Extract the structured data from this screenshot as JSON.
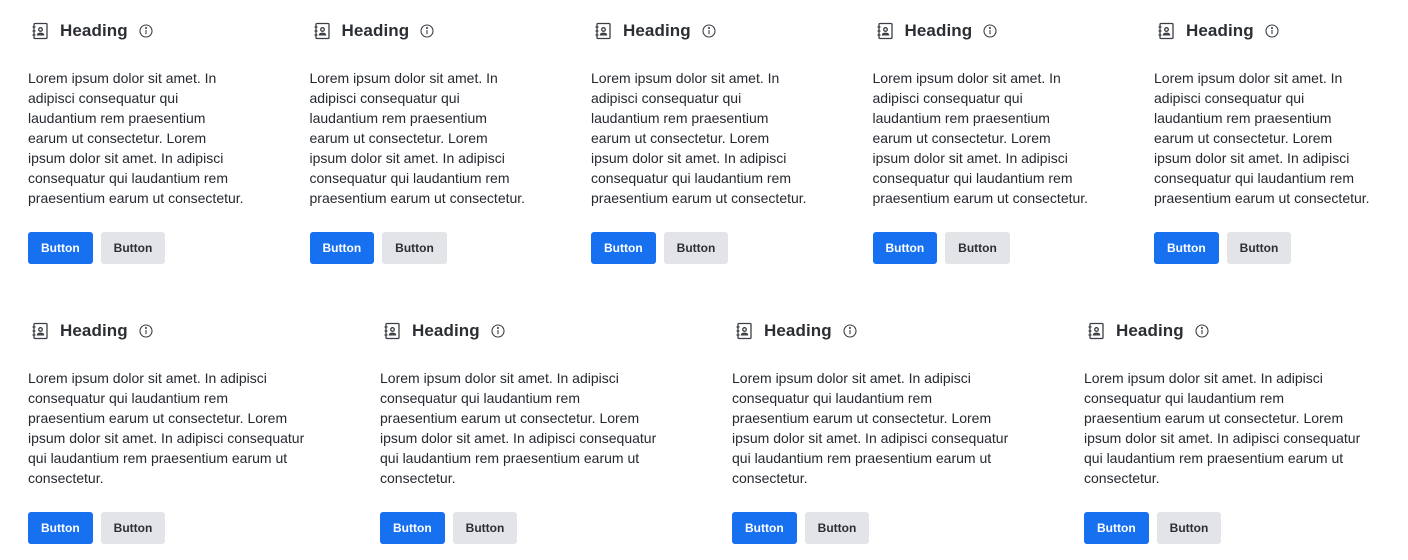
{
  "row1": [
    {
      "title": "Heading",
      "body": "Lorem ipsum dolor sit amet. In adipisci consequatur qui laudantium rem praesentium earum ut consectetur. Lorem ipsum dolor sit amet. In adipisci consequatur qui laudantium rem praesentium earum ut consectetur.",
      "primary_label": "Button",
      "secondary_label": "Button"
    },
    {
      "title": "Heading",
      "body": "Lorem ipsum dolor sit amet. In adipisci consequatur qui laudantium rem praesentium earum ut consectetur. Lorem ipsum dolor sit amet. In adipisci consequatur qui laudantium rem praesentium earum ut consectetur.",
      "primary_label": "Button",
      "secondary_label": "Button"
    },
    {
      "title": "Heading",
      "body": "Lorem ipsum dolor sit amet. In adipisci consequatur qui laudantium rem praesentium earum ut consectetur. Lorem ipsum dolor sit amet. In adipisci consequatur qui laudantium rem praesentium earum ut consectetur.",
      "primary_label": "Button",
      "secondary_label": "Button"
    },
    {
      "title": "Heading",
      "body": "Lorem ipsum dolor sit amet. In adipisci consequatur qui laudantium rem praesentium earum ut consectetur. Lorem ipsum dolor sit amet. In adipisci consequatur qui laudantium rem praesentium earum ut consectetur.",
      "primary_label": "Button",
      "secondary_label": "Button"
    },
    {
      "title": "Heading",
      "body": "Lorem ipsum dolor sit amet. In adipisci consequatur qui laudantium rem praesentium earum ut consectetur. Lorem ipsum dolor sit amet. In adipisci consequatur qui laudantium rem praesentium earum ut consectetur.",
      "primary_label": "Button",
      "secondary_label": "Button"
    }
  ],
  "row2": [
    {
      "title": "Heading",
      "body": "Lorem ipsum dolor sit amet. In adipisci consequatur qui laudantium rem praesentium earum ut consectetur. Lorem ipsum dolor sit amet. In adipisci consequatur qui laudantium rem praesentium earum ut consectetur.",
      "primary_label": "Button",
      "secondary_label": "Button"
    },
    {
      "title": "Heading",
      "body": "Lorem ipsum dolor sit amet. In adipisci consequatur qui laudantium rem praesentium earum ut consectetur. Lorem ipsum dolor sit amet. In adipisci consequatur qui laudantium rem praesentium earum ut consectetur.",
      "primary_label": "Button",
      "secondary_label": "Button"
    },
    {
      "title": "Heading",
      "body": "Lorem ipsum dolor sit amet. In adipisci consequatur qui laudantium rem praesentium earum ut consectetur. Lorem ipsum dolor sit amet. In adipisci consequatur qui laudantium rem praesentium earum ut consectetur.",
      "primary_label": "Button",
      "secondary_label": "Button"
    },
    {
      "title": "Heading",
      "body": "Lorem ipsum dolor sit amet. In adipisci consequatur qui laudantium rem praesentium earum ut consectetur. Lorem ipsum dolor sit amet. In adipisci consequatur qui laudantium rem praesentium earum ut consectetur.",
      "primary_label": "Button",
      "secondary_label": "Button"
    }
  ],
  "icons": {
    "card_icon": "contact-book-icon",
    "info_icon": "info-circle-icon"
  },
  "colors": {
    "primary": "#1670f0",
    "secondary": "#e2e4e7",
    "text": "#24292f"
  }
}
